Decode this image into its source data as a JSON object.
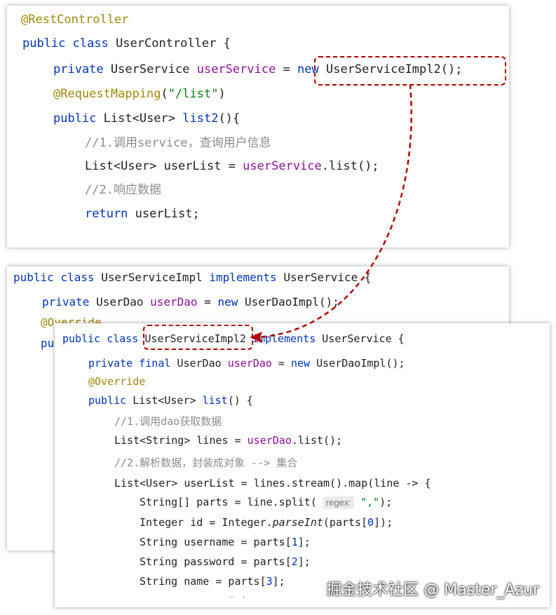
{
  "panel1": {
    "lines": [
      [
        {
          "t": "@RestController",
          "c": "ann"
        }
      ],
      [
        {
          "t": "public class ",
          "c": "kw"
        },
        {
          "t": "UserController {",
          "c": ""
        }
      ],
      [
        {
          "t": "private ",
          "c": "kw"
        },
        {
          "t": "UserService ",
          "c": ""
        },
        {
          "t": "userService",
          "c": "fld"
        },
        {
          "t": " = ",
          "c": ""
        },
        {
          "t": "new ",
          "c": "kw"
        },
        {
          "t": "UserServiceImpl2();",
          "c": ""
        }
      ],
      [
        {
          "t": "@RequestMapping",
          "c": "ann"
        },
        {
          "t": "(",
          "c": ""
        },
        {
          "t": "\"/list\"",
          "c": "str"
        },
        {
          "t": ")",
          "c": ""
        }
      ],
      [
        {
          "t": "public ",
          "c": "kw"
        },
        {
          "t": "List<User> ",
          "c": ""
        },
        {
          "t": "list2",
          "c": "kw"
        },
        {
          "t": "(){",
          "c": ""
        }
      ],
      [
        {
          "t": "//1.调用service，查询用户信息",
          "c": "cmt"
        }
      ],
      [
        {
          "t": "List<User> userList = ",
          "c": ""
        },
        {
          "t": "userService",
          "c": "fld"
        },
        {
          "t": ".list();",
          "c": ""
        }
      ],
      [
        {
          "t": "//2.响应数据",
          "c": "cmt"
        }
      ],
      [
        {
          "t": "return ",
          "c": "kw"
        },
        {
          "t": "userList;",
          "c": ""
        }
      ],
      [
        {
          "t": "}",
          "c": ""
        }
      ]
    ]
  },
  "panel2": {
    "lines": [
      [
        {
          "t": "public class ",
          "c": "kw"
        },
        {
          "t": "UserServiceImpl ",
          "c": ""
        },
        {
          "t": "implements ",
          "c": "kw"
        },
        {
          "t": "UserService {",
          "c": ""
        }
      ],
      [
        {
          "t": "private ",
          "c": "kw"
        },
        {
          "t": "UserDao ",
          "c": ""
        },
        {
          "t": "userDao",
          "c": "fld"
        },
        {
          "t": " = ",
          "c": ""
        },
        {
          "t": "new ",
          "c": "kw"
        },
        {
          "t": "UserDaoImpl();",
          "c": ""
        }
      ],
      [
        {
          "t": "@Override",
          "c": "ann"
        }
      ],
      [
        {
          "t": "pu",
          "c": "kw"
        }
      ]
    ]
  },
  "panel3": {
    "lines": [
      [
        {
          "t": "public class ",
          "c": "kw"
        },
        {
          "t": "UserServiceImpl2 ",
          "c": ""
        },
        {
          "t": "implements ",
          "c": "kw"
        },
        {
          "t": "UserService {",
          "c": ""
        }
      ],
      [
        {
          "t": "private final ",
          "c": "kw"
        },
        {
          "t": "UserDao ",
          "c": ""
        },
        {
          "t": "userDao",
          "c": "fld"
        },
        {
          "t": " = ",
          "c": ""
        },
        {
          "t": "new ",
          "c": "kw"
        },
        {
          "t": "UserDaoImpl();",
          "c": ""
        }
      ],
      [
        {
          "t": "@Override",
          "c": "ann"
        }
      ],
      [
        {
          "t": "public ",
          "c": "kw"
        },
        {
          "t": "List<User> ",
          "c": ""
        },
        {
          "t": "list",
          "c": "kw"
        },
        {
          "t": "() {",
          "c": ""
        }
      ],
      [
        {
          "t": "//1.调用dao获取数据",
          "c": "cmt"
        }
      ],
      [
        {
          "t": "List<String> lines = ",
          "c": ""
        },
        {
          "t": "userDao",
          "c": "fld"
        },
        {
          "t": ".list();",
          "c": ""
        }
      ],
      [
        {
          "t": "//2.解析数据，封装成对象 --> 集合",
          "c": "cmt"
        }
      ],
      [
        {
          "t": "List<User> userList = lines.stream().map(line -> {",
          "c": ""
        }
      ],
      [
        {
          "t": "String[] parts = line.split( ",
          "c": ""
        },
        {
          "t": "regex:",
          "c": "hint"
        },
        {
          "t": " ",
          "c": ""
        },
        {
          "t": "\",\"",
          "c": "str"
        },
        {
          "t": ");",
          "c": ""
        }
      ],
      [
        {
          "t": "Integer id = Integer.",
          "c": ""
        },
        {
          "t": "parseInt",
          "c": "ital"
        },
        {
          "t": "(parts[",
          "c": ""
        },
        {
          "t": "0",
          "c": "kw"
        },
        {
          "t": "]);",
          "c": ""
        }
      ],
      [
        {
          "t": "String username = parts[",
          "c": ""
        },
        {
          "t": "1",
          "c": "kw"
        },
        {
          "t": "];",
          "c": ""
        }
      ],
      [
        {
          "t": "String password = parts[",
          "c": ""
        },
        {
          "t": "2",
          "c": "kw"
        },
        {
          "t": "];",
          "c": ""
        }
      ],
      [
        {
          "t": "String name = parts[",
          "c": ""
        },
        {
          "t": "3",
          "c": "kw"
        },
        {
          "t": "];",
          "c": ""
        }
      ],
      [
        {
          "t": "Integer age = Inte",
          "c": ""
        }
      ]
    ]
  },
  "watermark": "掘金技术社区 @ Master_Azur",
  "colors": {
    "keyword": "#0033b3",
    "annotation": "#9e880d",
    "field": "#871094",
    "string": "#067d17",
    "comment": "#8c8c8c",
    "highlight": "#b00000"
  }
}
